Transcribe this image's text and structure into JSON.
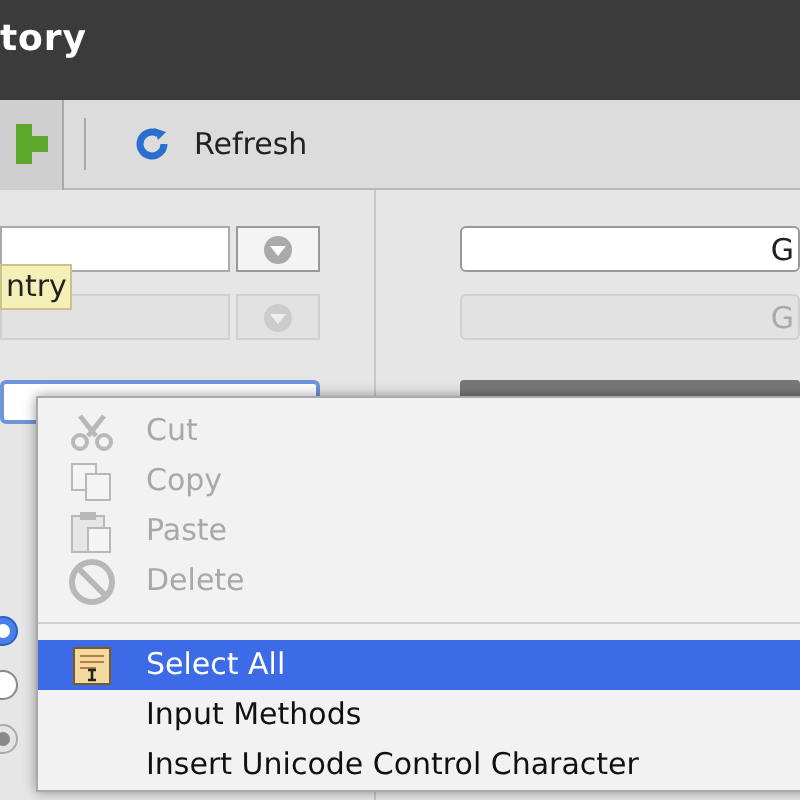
{
  "window": {
    "title": "tory"
  },
  "toolbar": {
    "refresh": "Refresh"
  },
  "left": {
    "tooltip": "ntry",
    "radios": [
      {
        "selected": true,
        "disabled": false
      },
      {
        "selected": false,
        "disabled": false
      },
      {
        "selected": true,
        "disabled": true
      }
    ]
  },
  "right": {
    "buttons": [
      {
        "label": "G",
        "disabled": false
      },
      {
        "label": "G",
        "disabled": true
      }
    ]
  },
  "context_menu": {
    "items": [
      {
        "kind": "item",
        "label": "Cut",
        "disabled": true,
        "selected": false
      },
      {
        "kind": "item",
        "label": "Copy",
        "disabled": true,
        "selected": false
      },
      {
        "kind": "item",
        "label": "Paste",
        "disabled": true,
        "selected": false
      },
      {
        "kind": "item",
        "label": "Delete",
        "disabled": true,
        "selected": false
      },
      {
        "kind": "separator"
      },
      {
        "kind": "item",
        "label": "Select All",
        "disabled": false,
        "selected": true
      },
      {
        "kind": "item",
        "label": "Input Methods",
        "disabled": false,
        "selected": false
      },
      {
        "kind": "item",
        "label": "Insert Unicode Control Character",
        "disabled": false,
        "selected": false
      }
    ]
  }
}
